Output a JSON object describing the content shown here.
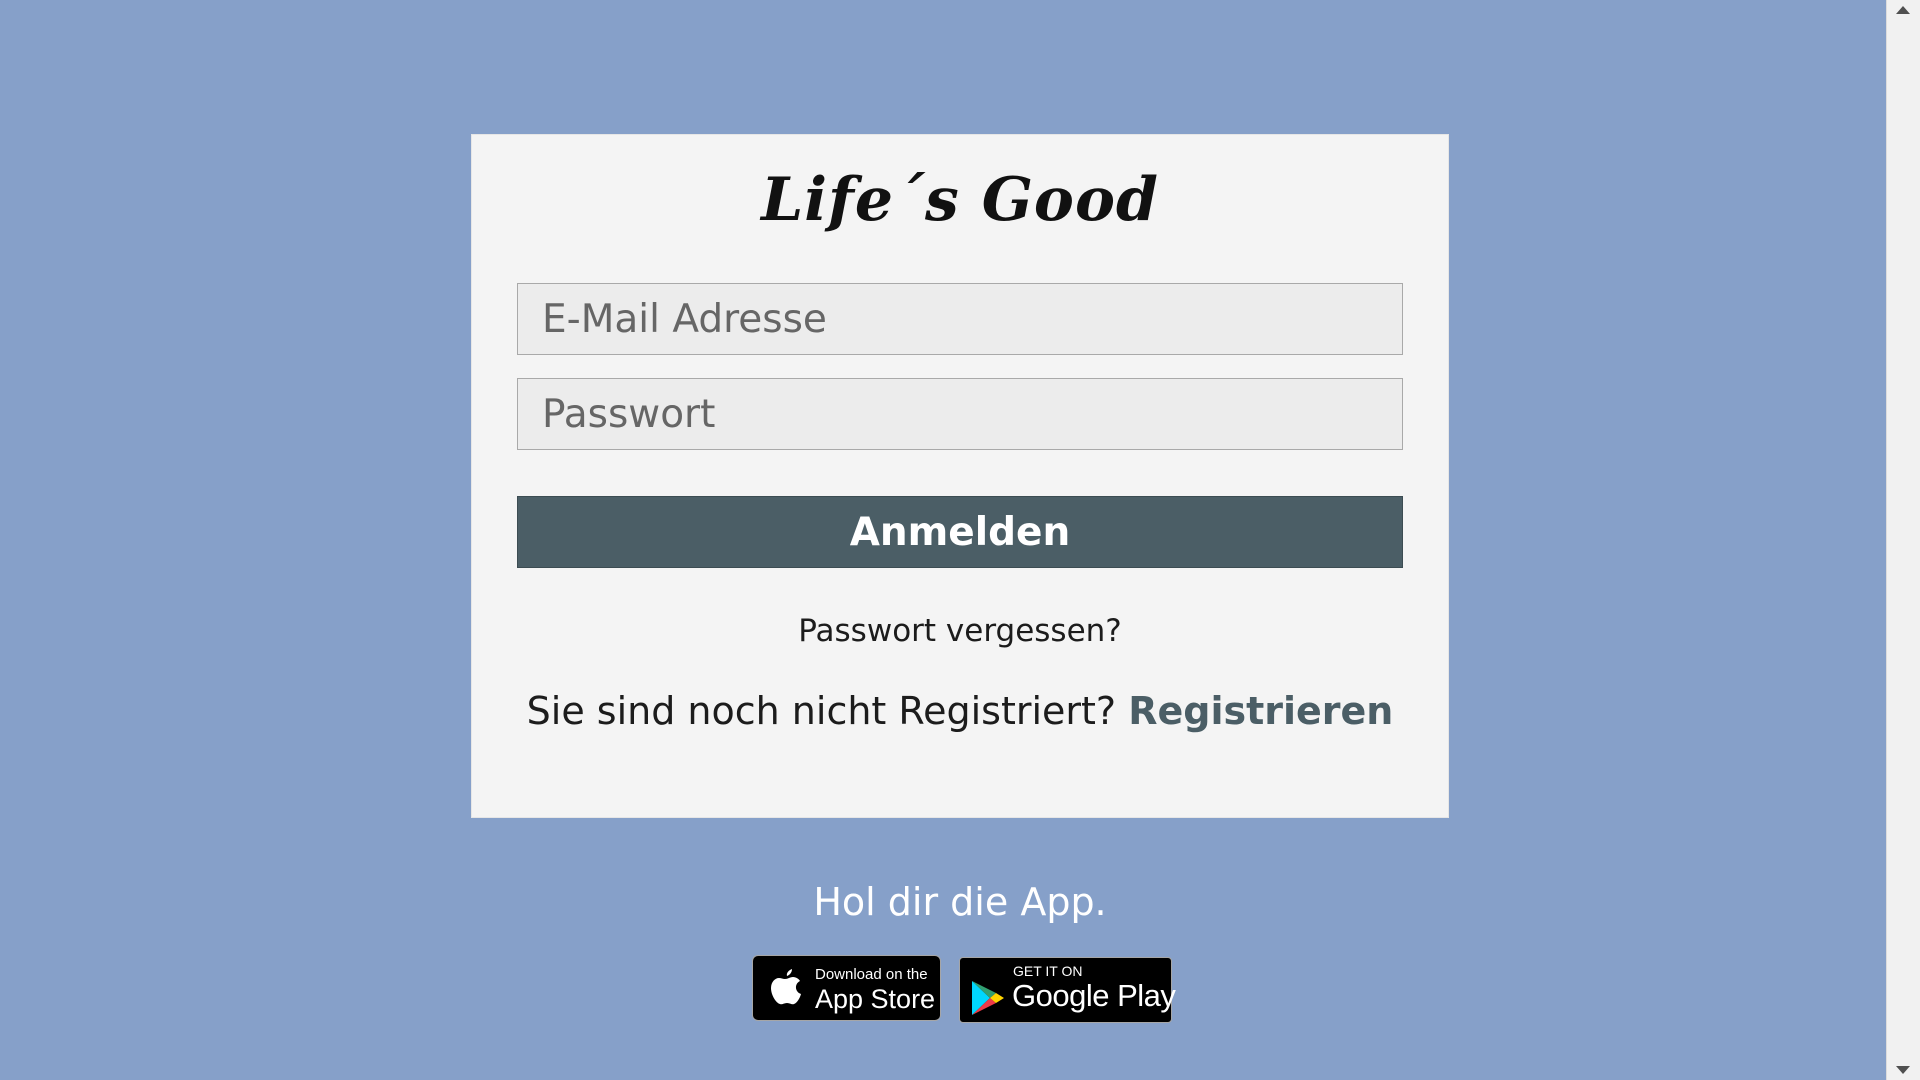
{
  "login": {
    "logo_text": "Life´s Good",
    "email_placeholder": "E-Mail Adresse",
    "password_placeholder": "Passwort",
    "submit_label": "Anmelden",
    "forgot_password": "Passwort vergessen?",
    "register_prompt": "Sie sind noch nicht Registriert?",
    "register_link": "Registrieren"
  },
  "app_promo": {
    "heading": "Hol dir die App.",
    "app_store": {
      "small": "Download on the",
      "big": "App Store"
    },
    "google_play": {
      "small": "GET IT ON",
      "big": "Google Play"
    }
  },
  "colors": {
    "background": "#86a0c9",
    "card": "#f4f4f4",
    "accent": "#4b5e66"
  }
}
